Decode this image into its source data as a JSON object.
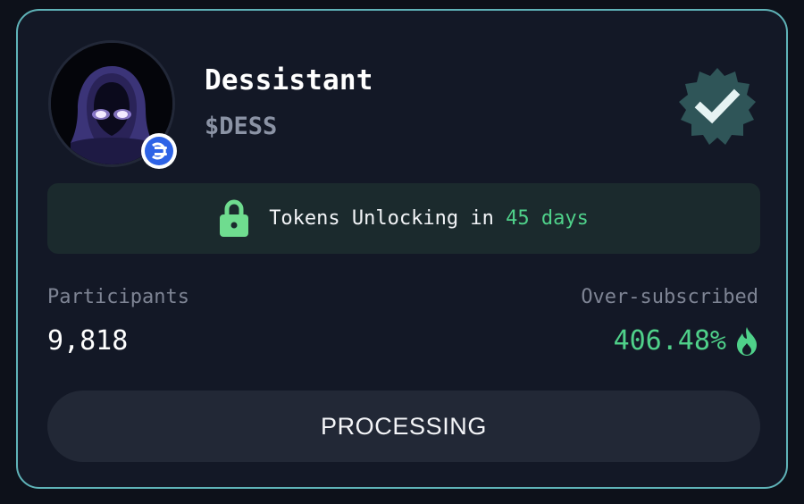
{
  "project": {
    "name": "Dessistant",
    "ticker": "$DESS",
    "avatar_icon": "hooded-figure-avatar",
    "chain_icon": "chain-network-icon",
    "verified_icon": "verified-check-badge-icon"
  },
  "unlock": {
    "icon": "lock-icon",
    "prefix": "Tokens Unlocking in ",
    "days": "45 days"
  },
  "stats": {
    "participants_label": "Participants",
    "participants_value": "9,818",
    "oversubscribed_label": "Over-subscribed",
    "oversubscribed_value": "406.48%",
    "oversubscribed_icon": "fire-icon"
  },
  "status_button": {
    "label": "PROCESSING"
  },
  "colors": {
    "accent_green": "#4fd18a",
    "border_teal": "#5fb3b8",
    "card_background": "#131826",
    "banner_background": "#1b2a2d",
    "chain_blue": "#2e63e6",
    "verified_badge": "#2f5558"
  }
}
